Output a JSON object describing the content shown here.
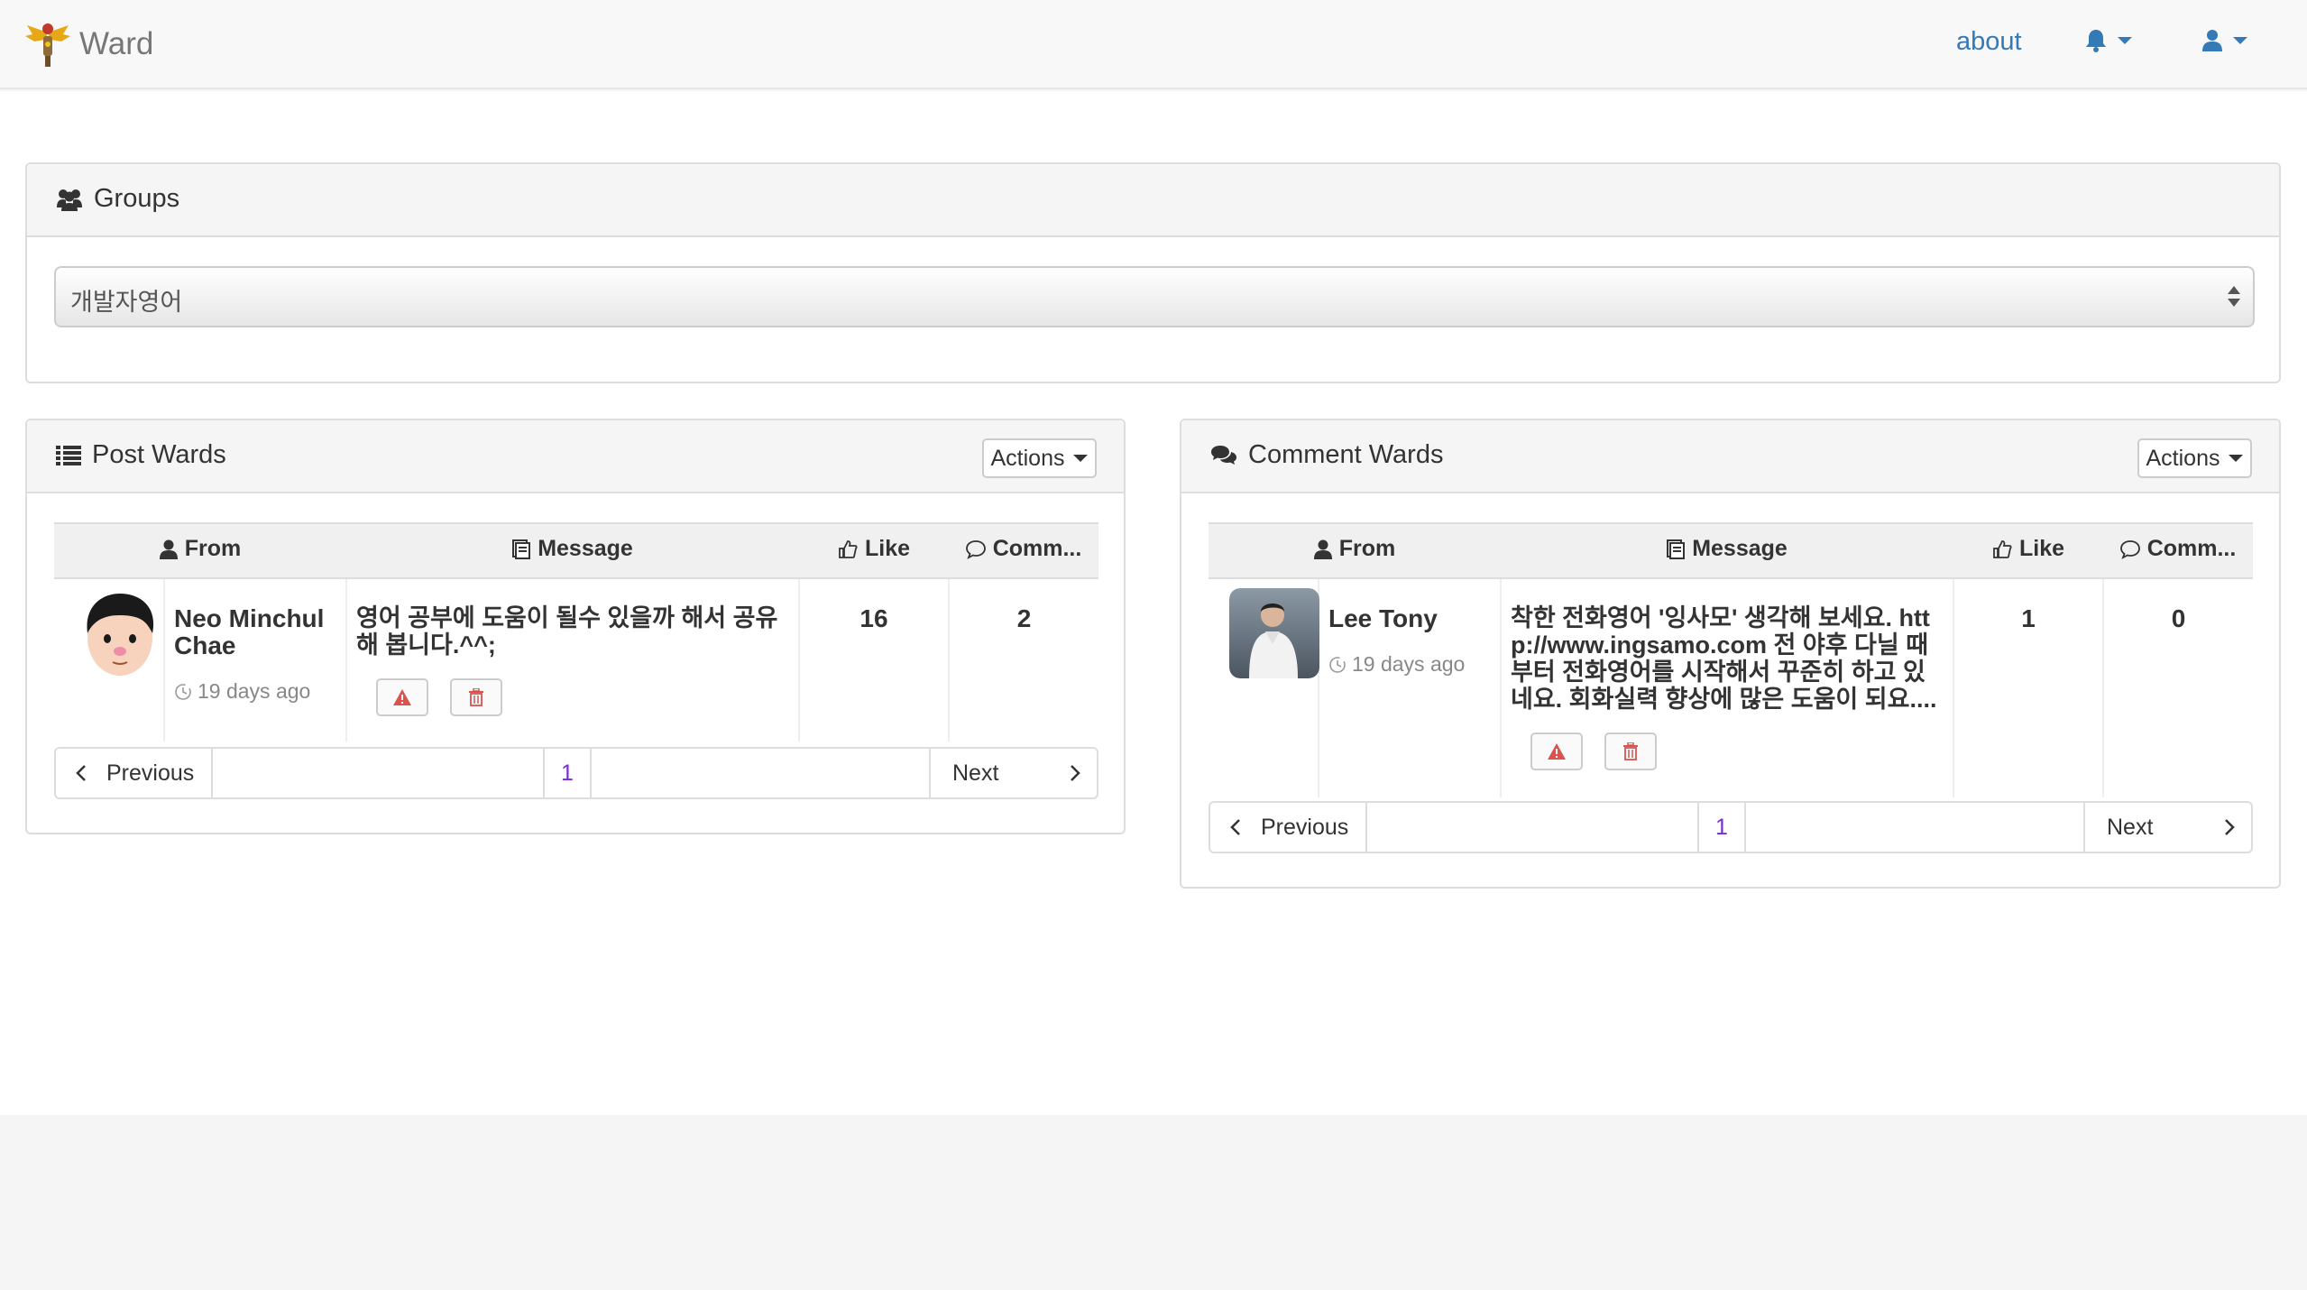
{
  "navbar": {
    "brand": "Ward",
    "about": "about",
    "notifications_icon": "bell-icon",
    "user_icon": "user-icon"
  },
  "groups": {
    "title": "Groups",
    "selected": "개발자영어"
  },
  "post_wards": {
    "title": "Post Wards",
    "actions_label": "Actions",
    "columns": {
      "from": "From",
      "message": "Message",
      "like": "Like",
      "comments": "Comm..."
    },
    "rows": [
      {
        "from": "Neo Minchul Chae",
        "time": "19 days ago",
        "message": "영어 공부에 도움이 될수 있을까 해서 공유해 봅니다.^^;",
        "likes": "16",
        "comments": "2"
      }
    ],
    "pagination": {
      "previous": "Previous",
      "page": "1",
      "next": "Next"
    }
  },
  "comment_wards": {
    "title": "Comment Wards",
    "actions_label": "Actions",
    "columns": {
      "from": "From",
      "message": "Message",
      "like": "Like",
      "comments": "Comm..."
    },
    "rows": [
      {
        "from": "Lee Tony",
        "time": "19 days ago",
        "message": "착한 전화영어 '잉사모' 생각해 보세요. http://www.ingsamo.com 전 야후 다닐 때부터 전화영어를 시작해서 꾸준히 하고 있네요. 회화실력 향상에 많은 도움이 되요....",
        "likes": "1",
        "comments": "0"
      }
    ],
    "pagination": {
      "previous": "Previous",
      "page": "1",
      "next": "Next"
    }
  },
  "colors": {
    "link": "#337ab7",
    "danger": "#d9534f",
    "page_active": "#7a2bd8"
  }
}
